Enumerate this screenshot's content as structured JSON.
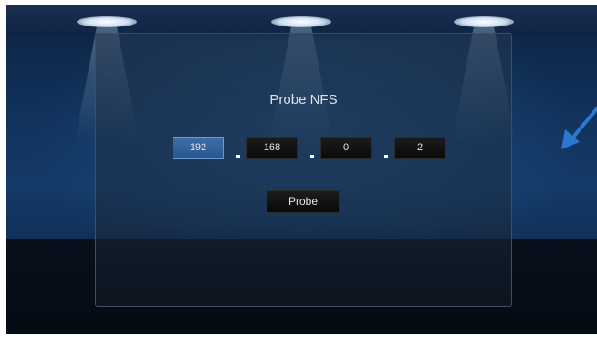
{
  "dialog": {
    "title": "Probe NFS"
  },
  "ip_address": {
    "octets": [
      "192",
      "168",
      "0",
      "2"
    ],
    "focused_index": 0
  },
  "actions": {
    "probe_label": "Probe"
  },
  "colors": {
    "background": "#123560",
    "focus": "#3d6ea8",
    "field": "#0f0f0f",
    "arrow": "#2a78d0"
  },
  "icons": {
    "indicator": "arrow-down-left-icon"
  }
}
